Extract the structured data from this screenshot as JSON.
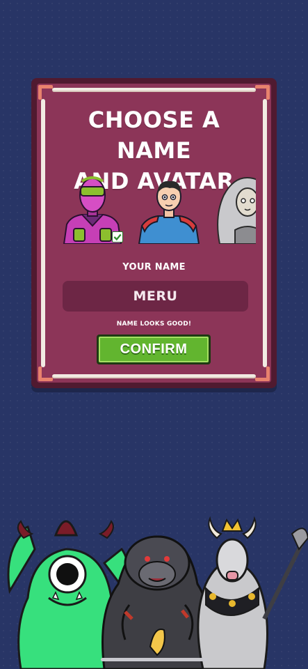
{
  "dialog": {
    "title_line1": "CHOOSE A NAME",
    "title_line2": "AND AVATAR",
    "name_label": "YOUR NAME",
    "name_value": "MERU",
    "status": "NAME LOOKS GOOD!",
    "confirm_label": "CONFIRM"
  },
  "avatars": [
    {
      "id": "robot-hero",
      "selected": true
    },
    {
      "id": "caped-hero",
      "selected": false
    },
    {
      "id": "silver-hair-hero",
      "selected": false
    }
  ],
  "monsters": [
    "cyclops-monster",
    "gorilla-monster",
    "minotaur-king-monster"
  ],
  "colors": {
    "background": "#283566",
    "dialog_border": "#501a30",
    "dialog_fill": "#8c3558",
    "input_fill": "#6d2645",
    "confirm_green": "#62b52f"
  }
}
